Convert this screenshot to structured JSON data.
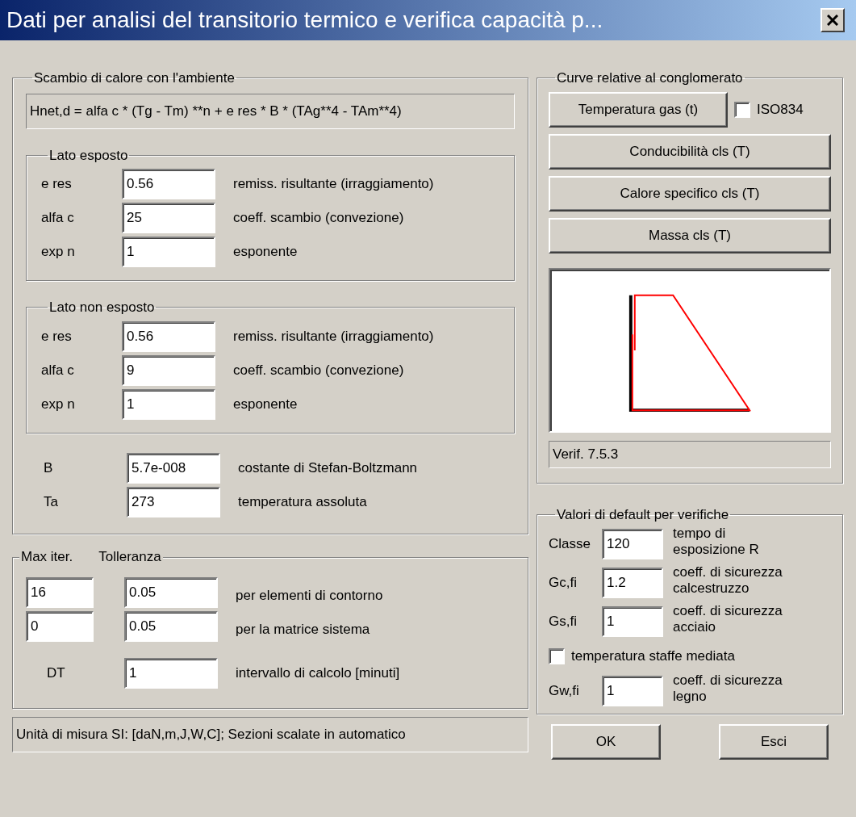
{
  "window": {
    "title": "Dati per analisi del transitorio termico e verifica capacità p..."
  },
  "heat_exchange": {
    "title": "Scambio di calore con l'ambiente",
    "formula": "Hnet,d = alfa c * (Tg - Tm) **n + e res * B * (TAg**4 - TAm**4)",
    "sides": [
      {
        "title": "Lato esposto",
        "rows": [
          {
            "label": "e res",
            "value": "0.56",
            "description": "remiss. risultante (irraggiamento)"
          },
          {
            "label": "alfa c",
            "value": "25",
            "description": "coeff. scambio (convezione)"
          },
          {
            "label": "exp n",
            "value": "1",
            "description": "esponente"
          }
        ]
      },
      {
        "title": "Lato non esposto",
        "rows": [
          {
            "label": "e res",
            "value": "0.56",
            "description": "remiss. risultante (irraggiamento)"
          },
          {
            "label": "alfa c",
            "value": "9",
            "description": "coeff. scambio (convezione)"
          },
          {
            "label": "exp n",
            "value": "1",
            "description": "esponente"
          }
        ]
      }
    ],
    "constants": [
      {
        "label": "B",
        "value": "5.7e-008",
        "description": "costante di Stefan-Boltzmann"
      },
      {
        "label": "Ta",
        "value": "273",
        "description": "temperatura assoluta"
      }
    ]
  },
  "iteration": {
    "headers": [
      "Max iter.",
      "Tolleranza"
    ],
    "rows": [
      {
        "max_iter": "16",
        "tolerance": "0.05",
        "description": "per elementi di contorno"
      },
      {
        "max_iter": "0",
        "tolerance": "0.05",
        "description": "per la matrice sistema"
      }
    ],
    "dt": {
      "label": "DT",
      "value": "1",
      "description": "intervallo di calcolo [minuti]"
    }
  },
  "status_bar": "Unità di misura SI: [daN,m,J,W,C]; Sezioni scalate in automatico",
  "curves": {
    "title": "Curve relative al conglomerato",
    "buttons": [
      "Temperatura gas (t)",
      "Conducibilità cls (T)",
      "Calore specifico cls (T)",
      "Massa cls (T)"
    ],
    "iso_checkbox": {
      "label": "ISO834",
      "checked": false
    },
    "preview_caption": "Verif. 7.5.3"
  },
  "defaults": {
    "title": "Valori di default per verifiche",
    "rows": [
      {
        "kind": "field",
        "label": "Classe",
        "value": "120",
        "description": "tempo di esposizione R"
      },
      {
        "kind": "field",
        "label": "Gc,fi",
        "value": "1.2",
        "description": "coeff. di sicurezza calcestruzzo"
      },
      {
        "kind": "field",
        "label": "Gs,fi",
        "value": "1",
        "description": "coeff. di sicurezza acciaio"
      },
      {
        "kind": "checkbox",
        "label": "temperatura staffe mediata",
        "checked": false
      },
      {
        "kind": "field",
        "label": "Gw,fi",
        "value": "1",
        "description": "coeff. di sicurezza legno"
      }
    ]
  },
  "buttons": [
    "OK",
    "Esci"
  ]
}
